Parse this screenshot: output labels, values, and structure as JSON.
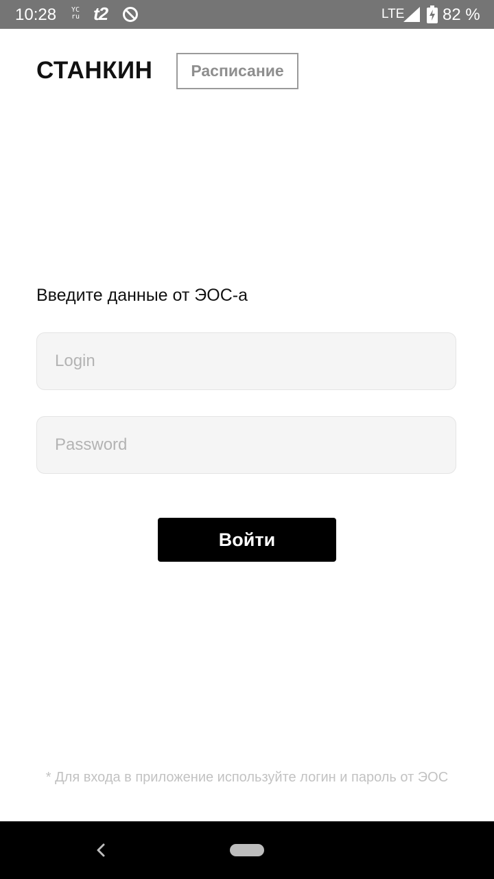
{
  "status_bar": {
    "time": "10:28",
    "yc_top": "YC",
    "yc_bottom": "ru",
    "carrier": "t2",
    "network": "LTE",
    "battery": "82 %",
    "icons": [
      "dnd-icon",
      "signal-icon",
      "battery-charging-icon"
    ]
  },
  "header": {
    "logo": "СТАНКИН",
    "schedule_button": "Расписание"
  },
  "form": {
    "prompt": "Введите данные от ЭОС-а",
    "login": {
      "value": "",
      "placeholder": "Login"
    },
    "password": {
      "value": "",
      "placeholder": "Password"
    },
    "submit_label": "Войти"
  },
  "footnote": "* Для входа в приложение используйте логин и пароль от ЭОС",
  "nav_bar": {
    "icons": [
      "back-icon",
      "home-pill-icon"
    ]
  },
  "colors": {
    "status_bar_bg": "#757575",
    "field_bg": "#f5f5f5",
    "button_bg": "#000000",
    "footnote_text": "#c2c2c2"
  }
}
